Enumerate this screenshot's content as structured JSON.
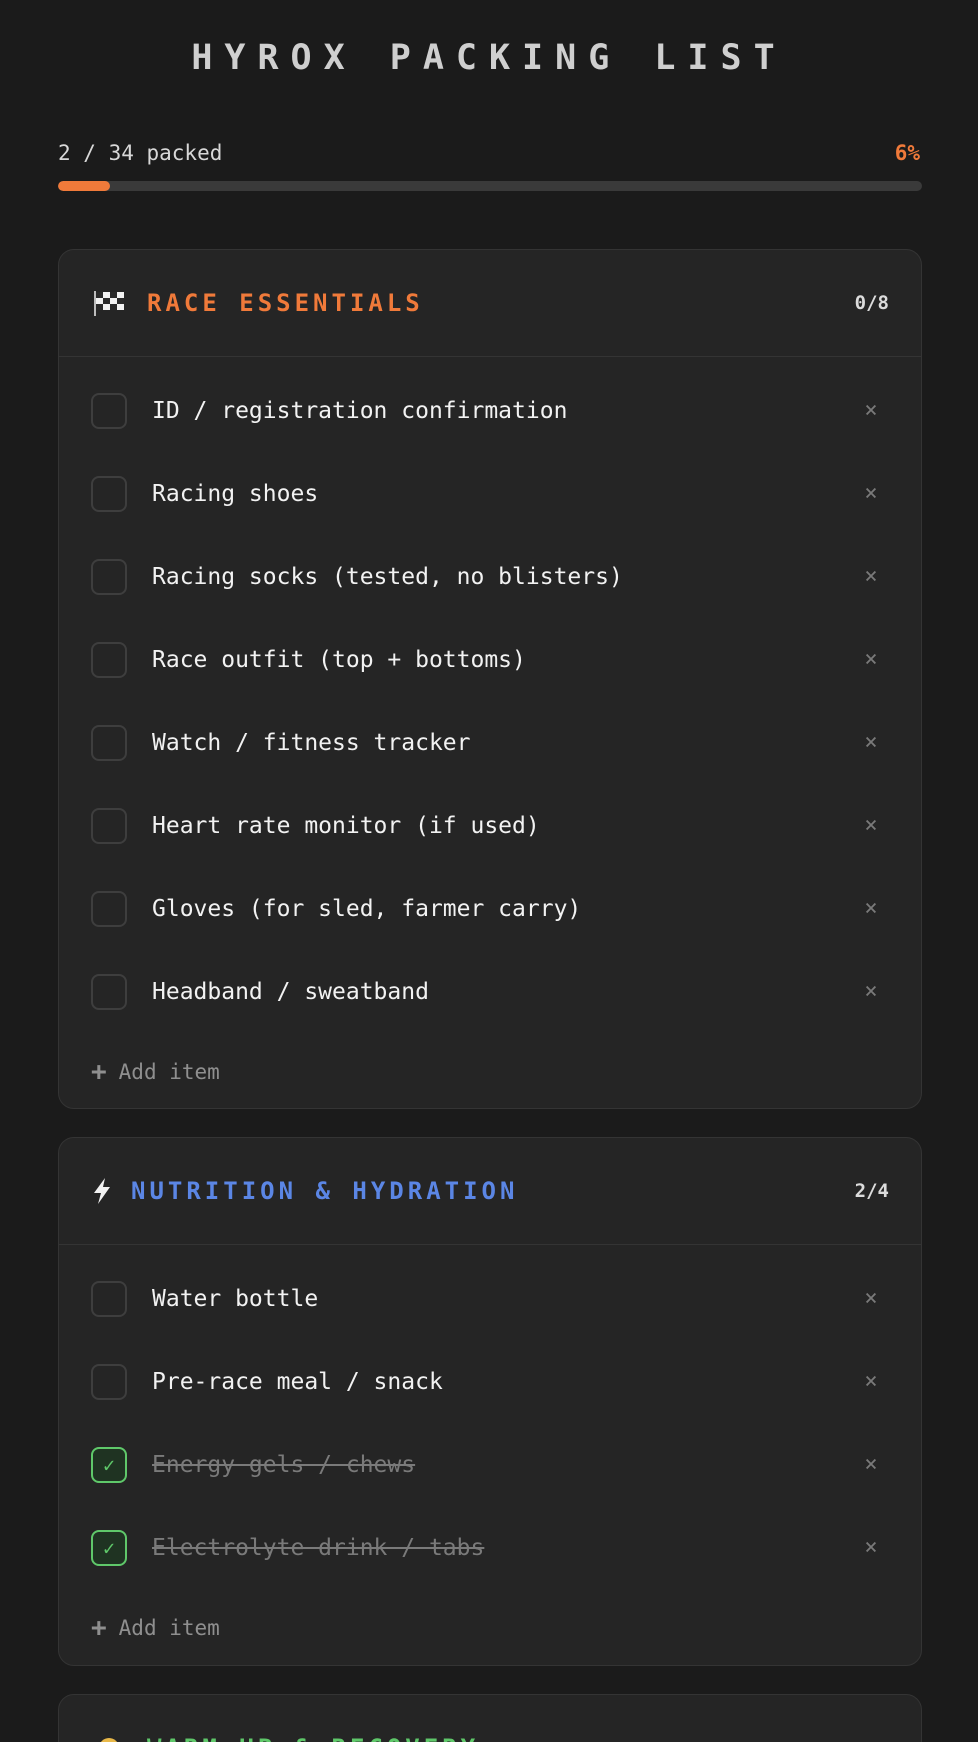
{
  "app": {
    "title": "HYROX PACKING LIST"
  },
  "progress": {
    "label": "2 / 34 packed",
    "percent_text": "6%",
    "fraction": 0.06,
    "accent": "#f07a3a"
  },
  "categories": [
    {
      "icon": "checkered-flag-icon",
      "title": "RACE ESSENTIALS",
      "count": "0/8",
      "color": "#f07a3a",
      "add_label": "Add item",
      "items": [
        {
          "label": "ID / registration confirmation",
          "checked": false
        },
        {
          "label": "Racing shoes",
          "checked": false
        },
        {
          "label": "Racing socks (tested, no blisters)",
          "checked": false
        },
        {
          "label": "Race outfit (top + bottoms)",
          "checked": false
        },
        {
          "label": "Watch / fitness tracker",
          "checked": false
        },
        {
          "label": "Heart rate monitor (if used)",
          "checked": false
        },
        {
          "label": "Gloves (for sled, farmer carry)",
          "checked": false
        },
        {
          "label": "Headband / sweatband",
          "checked": false
        }
      ]
    },
    {
      "icon": "lightning-bolt-icon",
      "title": "NUTRITION & HYDRATION",
      "count": "2/4",
      "color": "#5b86e5",
      "add_label": "Add item",
      "items": [
        {
          "label": "Water bottle",
          "checked": false
        },
        {
          "label": "Pre-race meal / snack",
          "checked": false
        },
        {
          "label": "Energy gels / chews",
          "checked": true
        },
        {
          "label": "Electrolyte drink / tabs",
          "checked": true
        }
      ]
    },
    {
      "icon": "flexed-arm-icon",
      "title": "WARM-UP & RECOVERY",
      "color": "#5fc86a",
      "items": []
    }
  ],
  "icons": {
    "remove": "close-icon",
    "check": "checkmark-icon",
    "add": "plus-icon"
  }
}
